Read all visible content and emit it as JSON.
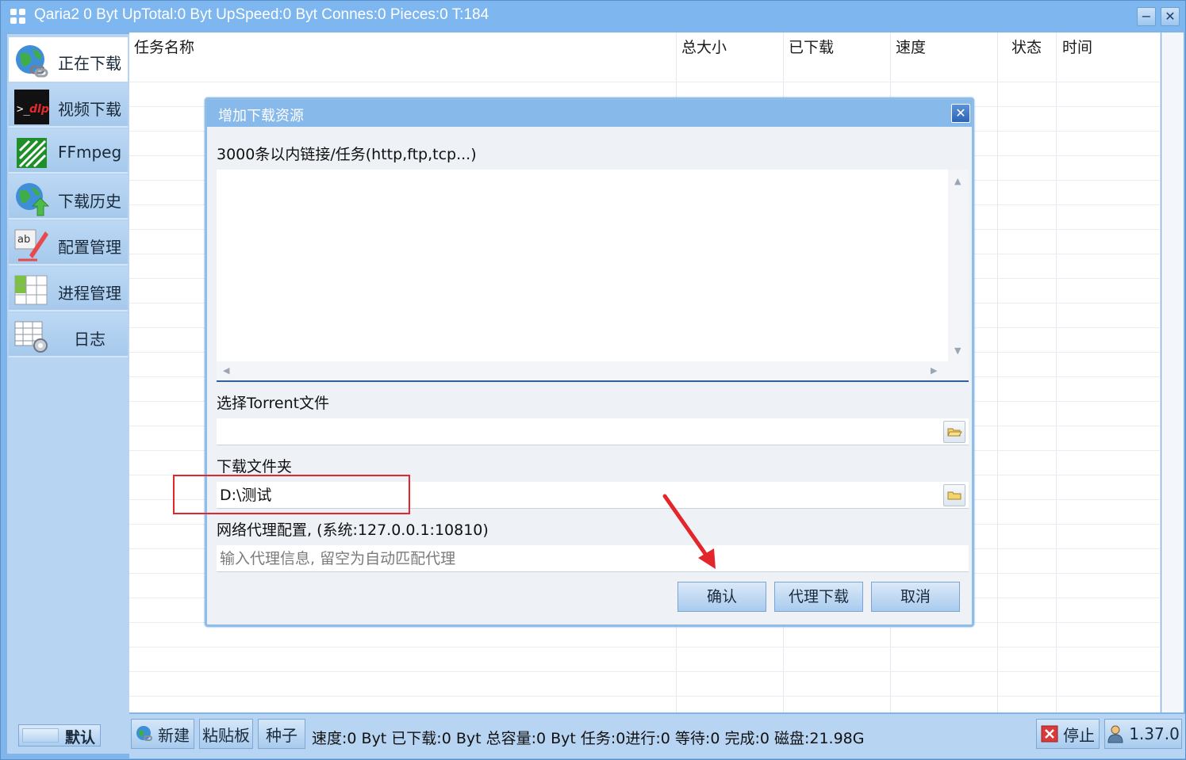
{
  "window": {
    "title": "Qaria2 0 Byt UpTotal:0 Byt UpSpeed:0 Byt Connes:0 Pieces:0 T:184",
    "minimize_label": "−",
    "close_label": "✕"
  },
  "sidebar": {
    "items": [
      {
        "label": "正在下载",
        "icon": "globe-link-icon",
        "active": true
      },
      {
        "label": "视频下载",
        "icon": "ytdlp-terminal-icon",
        "active": false
      },
      {
        "label": "FFmpeg",
        "icon": "ffmpeg-icon",
        "active": false
      },
      {
        "label": "下载历史",
        "icon": "globe-upload-icon",
        "active": false
      },
      {
        "label": "配置管理",
        "icon": "abc-edit-icon",
        "active": false
      },
      {
        "label": "进程管理",
        "icon": "grid-icon",
        "active": false
      },
      {
        "label": "日志",
        "icon": "table-gear-icon",
        "active": false
      }
    ],
    "default_label": "默认"
  },
  "table": {
    "columns": [
      "任务名称",
      "总大小",
      "已下载",
      "速度",
      "状态",
      "时间"
    ]
  },
  "toolbar": {
    "new_label": "新建",
    "paste_label": "粘贴板",
    "torrent_label": "种子",
    "status": "速度:0 Byt 已下载:0 Byt 总容量:0 Byt 任务:0进行:0 等待:0 完成:0 磁盘:21.98G",
    "stop_label": "停止",
    "version_label": "1.37.0"
  },
  "dialog": {
    "title": "增加下载资源",
    "close_label": "✕",
    "links_label": "3000条以内链接/任务(http,ftp,tcp...)",
    "links_value": "",
    "torrent_label": "选择Torrent文件",
    "torrent_value": "",
    "folder_label": "下载文件夹",
    "folder_value": "D:\\测试",
    "proxy_label": "网络代理配置, (系统:127.0.0.1:10810)",
    "proxy_placeholder": "输入代理信息, 留空为自动匹配代理",
    "confirm_label": "确认",
    "proxy_download_label": "代理下载",
    "cancel_label": "取消"
  },
  "annotations": {
    "highlight_color": "#e3262b",
    "arrow_color": "#e3262b"
  }
}
